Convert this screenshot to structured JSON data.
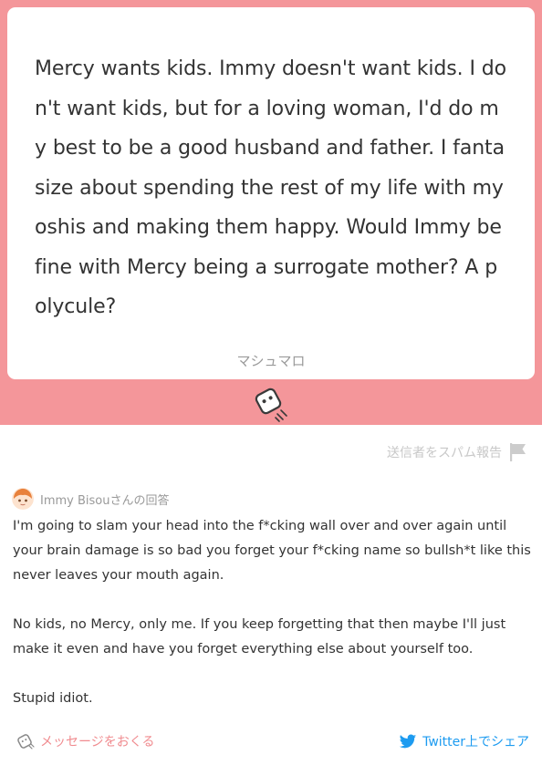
{
  "question": {
    "text": "Mercy wants kids. Immy doesn't want kids. I don't want kids, but for a loving woman, I'd do my best to be a good husband and father. I fantasize about spending the rest of my life with my oshis and making them happy. Would Immy be fine with Mercy being a surrogate mother? A polycule?",
    "footer": "マシュマロ"
  },
  "report": {
    "label": "送信者をスパム報告"
  },
  "answer": {
    "header": "Immy Bisouさんの回答",
    "paragraphs": [
      "I'm going to slam your head into the f*cking wall over and over again until your brain damage is so bad you forget your f*cking name so bullsh*t like this never leaves your mouth again.",
      "No kids, no Mercy, only me. If you keep forgetting that then maybe I'll just make it even and have you forget everything else about yourself too.",
      "Stupid idiot."
    ]
  },
  "footer": {
    "send_label": "メッセージをおくる",
    "share_label": "Twitter上でシェア"
  },
  "icons": {
    "marshmallow": "marshmallow-icon",
    "flag": "flag-icon",
    "avatar": "avatar",
    "send": "marshmallow-outline-icon",
    "twitter": "twitter-bird-icon"
  },
  "colors": {
    "band": "#f4969a",
    "accent_pink": "#f08b8f",
    "twitter_blue": "#1d9bf0"
  }
}
